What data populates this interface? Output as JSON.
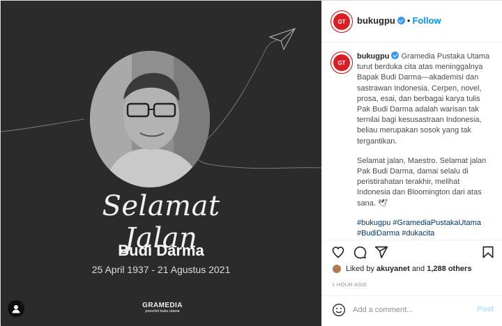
{
  "post_image": {
    "script_title": "Selamat Jalan",
    "person_name": "Budi Darma",
    "person_dates": "25 April 1937 - 21 Agustus 2021",
    "brand_name": "GRAMEDIA",
    "brand_tagline": "penerbit buku utama",
    "avatar_mark": "GT"
  },
  "header": {
    "username": "bukugpu",
    "separator": "•",
    "follow_label": "Follow"
  },
  "caption": {
    "username": "bukugpu",
    "paragraphs": [
      "Gramedia Pustaka Utama turut berduka cita atas meninggalnya Bapak Budi Darma—akademisi dan sastrawan Indonesia. Cerpen, novel, prosa, esai, dan berbagai karya tulis Pak Budi Darma adalah warisan tak ternilai bagi kesusastraan Indonesia, beliau merupakan sosok yang tak tergantikan.",
      "Selamat jalan, Maestro. Selamat jalan Pak Budi Darma, damai selalu di peristirahatan terakhir, melihat Indonesia dan Bloomington dari atas sana. 🕊"
    ],
    "hashtags": [
      "#bukugpu",
      "#GramediaPustakaUtama",
      "#BudiDarma",
      "#dukacita"
    ]
  },
  "likes": {
    "prefix": "Liked by",
    "user": "akuyanet",
    "conjunction": "and",
    "others": "1,288 others"
  },
  "timestamp": "1 HOUR AGO",
  "comment": {
    "placeholder": "Add a comment...",
    "post_label": "Post"
  },
  "icons": {
    "like": "heart-icon",
    "comment": "comment-icon",
    "share": "paper-plane-icon",
    "save": "bookmark-icon",
    "emoji": "smiley-icon",
    "tag": "user-tag-icon"
  },
  "colors": {
    "image_bg": "#2b2b2b",
    "brand_red": "#d81f26",
    "link_blue": "#0095f6",
    "hashtag_blue": "#00376b",
    "verified_blue": "#3897f0"
  }
}
